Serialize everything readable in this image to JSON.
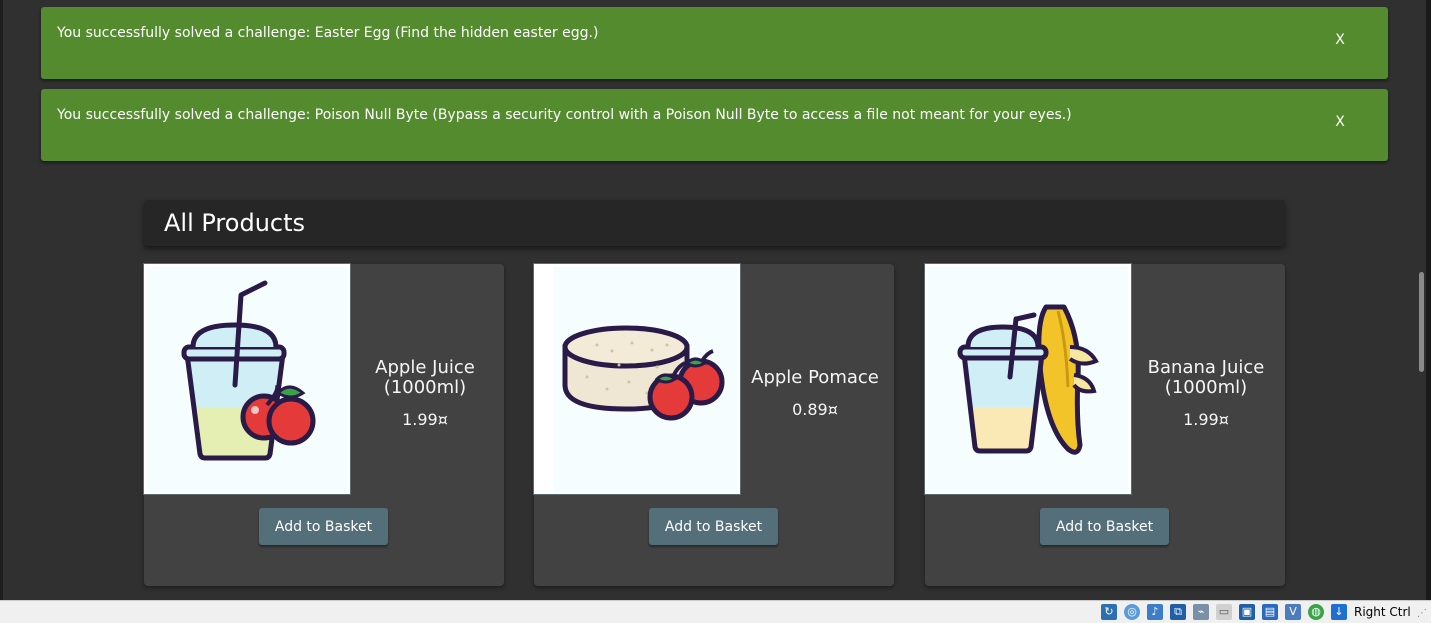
{
  "notifications": [
    {
      "message": "You successfully solved a challenge: Easter Egg (Find the hidden easter egg.)",
      "close": "X"
    },
    {
      "message": "You successfully solved a challenge: Poison Null Byte (Bypass a security control with a Poison Null Byte to access a file not meant for your eyes.)",
      "close": "X"
    }
  ],
  "section_title": "All Products",
  "products": [
    {
      "name": "Apple Juice (1000ml)",
      "price": "1.99¤",
      "button": "Add to Basket",
      "image": "apple-juice-illustration"
    },
    {
      "name": "Apple Pomace",
      "price": "0.89¤",
      "button": "Add to Basket",
      "image": "apple-pomace-illustration"
    },
    {
      "name": "Banana Juice (1000ml)",
      "price": "1.99¤",
      "button": "Add to Basket",
      "image": "banana-juice-illustration"
    }
  ],
  "statusbar": {
    "host_key": "Right Ctrl",
    "icons": [
      "mouse-capture-icon",
      "optical-drive-icon",
      "audio-icon",
      "network-icon",
      "usb-icon",
      "shared-folder-icon",
      "display-icon",
      "video-capture-icon",
      "vrde-icon",
      "cpu-icon",
      "guest-additions-icon",
      "host-key-arrow-icon"
    ]
  },
  "colors": {
    "background": "#303030",
    "toast": "#548b2f",
    "card": "#424242",
    "button": "#546e7a"
  }
}
